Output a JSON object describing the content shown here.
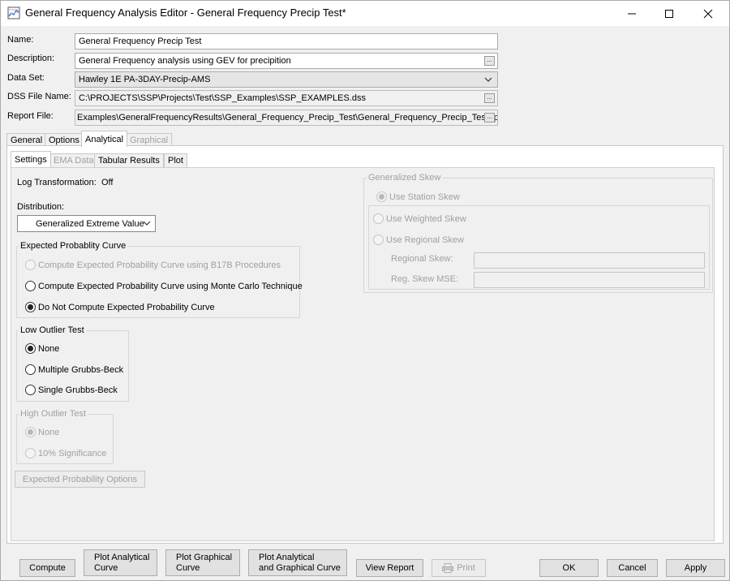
{
  "window": {
    "title": "General Frequency Analysis Editor - General Frequency Precip Test*",
    "minimize_icon": "minimize-icon",
    "maximize_icon": "maximize-icon",
    "close_icon": "close-icon"
  },
  "form": {
    "name_label": "Name:",
    "name_value": "General Frequency Precip Test",
    "description_label": "Description:",
    "description_value": "General Frequency analysis using GEV for precipition",
    "dataset_label": "Data Set:",
    "dataset_value": "Hawley 1E PA-3DAY-Precip-AMS",
    "dss_label": "DSS File Name:",
    "dss_value": "C:\\PROJECTS\\SSP\\Projects\\Test\\SSP_Examples\\SSP_EXAMPLES.dss",
    "report_label": "Report File:",
    "report_value": "Examples\\GeneralFrequencyResults\\General_Frequency_Precip_Test\\General_Frequency_Precip_Test.rpt",
    "browse_label": "..."
  },
  "main_tabs": [
    "General",
    "Options",
    "Analytical",
    "Graphical"
  ],
  "sub_tabs": [
    "Settings",
    "EMA Data",
    "Tabular Results",
    "Plot"
  ],
  "settings": {
    "log_transform_label": "Log Transformation:",
    "log_transform_value": "Off",
    "distribution_label": "Distribution:",
    "distribution_value": "Generalized Extreme Value",
    "expected_prob": {
      "title": "Expected Probablity Curve",
      "options": [
        "Compute Expected Probability Curve using B17B Procedures",
        "Compute Expected Probability Curve using Monte Carlo Technique",
        "Do Not Compute Expected Probability Curve"
      ],
      "selected": 2
    },
    "low_outlier": {
      "title": "Low Outlier Test",
      "options": [
        "None",
        "Multiple Grubbs-Beck",
        "Single Grubbs-Beck"
      ],
      "selected": 0
    },
    "high_outlier": {
      "title": "High Outlier Test",
      "options": [
        "None",
        "10% Significance"
      ],
      "selected": 0
    },
    "expected_prob_options_button": "Expected Probability Options",
    "generalized_skew": {
      "title": "Generalized Skew",
      "options": [
        "Use Station Skew",
        "Use Weighted Skew",
        "Use Regional Skew"
      ],
      "selected": 0,
      "regional_skew_label": "Regional Skew:",
      "reg_skew_mse_label": "Reg. Skew MSE:"
    }
  },
  "bottom_buttons": {
    "compute": "Compute",
    "plot_analytical_1": "Plot Analytical",
    "plot_analytical_2": "Curve",
    "plot_graphical_1": "Plot Graphical",
    "plot_graphical_2": "Curve",
    "plot_both_1": "Plot Analytical",
    "plot_both_2": "and Graphical Curve",
    "view_report": "View Report",
    "print": "Print",
    "ok": "OK",
    "cancel": "Cancel",
    "apply": "Apply"
  }
}
